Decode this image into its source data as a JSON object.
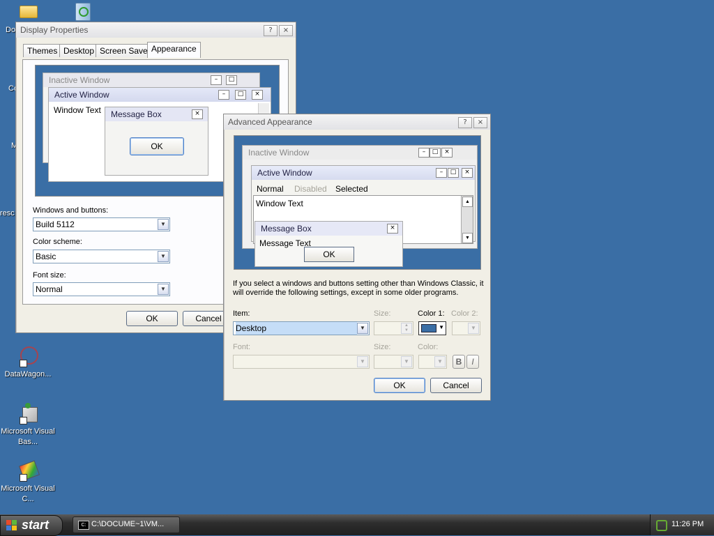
{
  "desktop_icons": [
    {
      "label": "Do"
    },
    {
      "label": "Co"
    },
    {
      "label": "M"
    },
    {
      "label": "resc"
    },
    {
      "label": "DataWagon..."
    },
    {
      "label": "Microsoft Visual Bas..."
    },
    {
      "label": "Microsoft Visual C..."
    }
  ],
  "display_properties": {
    "title": "Display Properties",
    "help": "?",
    "close": "×",
    "tabs": [
      "Themes",
      "Desktop",
      "Screen Saver",
      "Appearance"
    ],
    "active_tab": "Appearance",
    "preview": {
      "inactive_title": "Inactive Window",
      "active_title": "Active Window",
      "window_text": "Window Text",
      "msgbox_title": "Message Box",
      "msgbox_ok": "OK"
    },
    "windows_buttons_label": "Windows and buttons:",
    "windows_buttons_value": "Build 5112",
    "color_scheme_label": "Color scheme:",
    "color_scheme_value": "Basic",
    "font_size_label": "Font size:",
    "font_size_value": "Normal",
    "ok": "OK",
    "cancel": "Cancel"
  },
  "advanced": {
    "title": "Advanced Appearance",
    "help": "?",
    "close": "×",
    "preview": {
      "inactive_title": "Inactive Window",
      "active_title": "Active Window",
      "menu_normal": "Normal",
      "menu_disabled": "Disabled",
      "menu_selected": "Selected",
      "window_text": "Window Text",
      "msgbox_title": "Message Box",
      "msgbox_text": "Message Text",
      "msgbox_ok": "OK"
    },
    "note": "If you select a windows and buttons setting other than Windows Classic, it will override the following settings, except in some older programs.",
    "item_label": "Item:",
    "item_value": "Desktop",
    "size_label": "Size:",
    "color1_label": "Color 1:",
    "color1_value": "#3a6ea5",
    "color2_label": "Color 2:",
    "font_label": "Font:",
    "font_size_label": "Size:",
    "font_color_label": "Color:",
    "bold": "B",
    "italic": "I",
    "ok": "OK",
    "cancel": "Cancel"
  },
  "taskbar": {
    "start_label": "start",
    "task_label": "C:\\DOCUME~1\\VM...",
    "clock": "11:26 PM"
  }
}
